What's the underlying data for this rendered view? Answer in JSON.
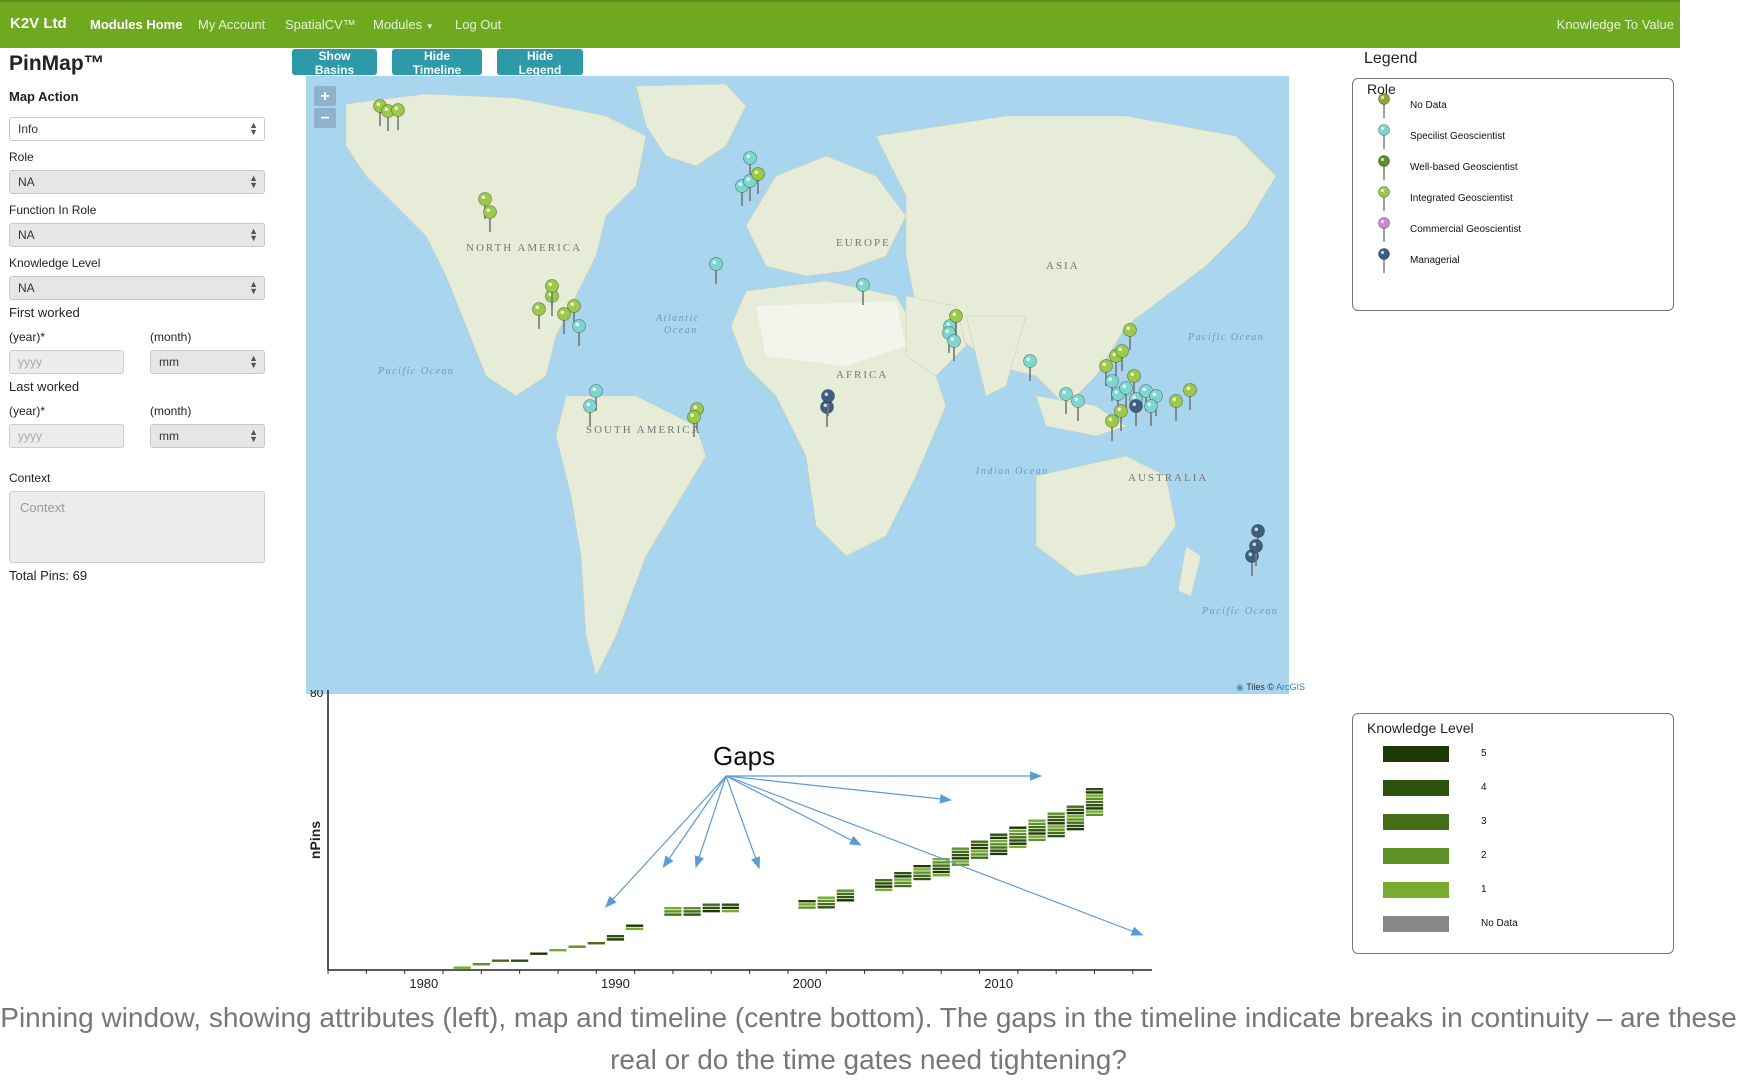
{
  "navbar": {
    "brand": "K2V Ltd",
    "items": [
      "Modules Home",
      "My Account",
      "SpatialCV™",
      "Modules",
      "Log Out"
    ],
    "tagline": "Knowledge To Value",
    "bg_color": "#6fa91f"
  },
  "sidebar": {
    "title": "PinMap™",
    "map_action_label": "Map Action",
    "map_action_value": "Info",
    "role_label": "Role",
    "role_value": "NA",
    "function_label": "Function In Role",
    "function_value": "NA",
    "knowledge_label": "Knowledge Level",
    "knowledge_value": "NA",
    "first_worked_label": "First worked",
    "last_worked_label": "Last worked",
    "year_label": "(year)*",
    "month_label": "(month)",
    "year_placeholder": "yyyy",
    "month_value": "mm",
    "context_label": "Context",
    "context_placeholder": "Context",
    "total_pins": "Total Pins: 69"
  },
  "toolbar": {
    "show_basins": "Show Basins",
    "hide_timeline": "Hide Timeline",
    "hide_legend": "Hide Legend"
  },
  "map": {
    "zoom_in": "+",
    "zoom_out": "−",
    "labels": {
      "north_america": "NORTH AMERICA",
      "south_america": "SOUTH AMERICA",
      "europe": "EUROPE",
      "asia": "ASIA",
      "africa": "AFRICA",
      "australia": "AUSTRALIA",
      "atlantic1": "Atlantic",
      "atlantic2": "Ocean",
      "pacific": "Pacific Ocean",
      "indian": "Indian Ocean"
    },
    "attribution_prefix": "Tiles ©",
    "attribution_link": "ArcGIS"
  },
  "legend": {
    "title": "Legend",
    "role_title": "Role",
    "roles": [
      {
        "label": "No Data",
        "color": "#8aa832"
      },
      {
        "label": "Specilist Geoscientist",
        "color": "#7fd6cf"
      },
      {
        "label": "Well-based Geoscientist",
        "color": "#5a8f2a"
      },
      {
        "label": "Integrated Geoscientist",
        "color": "#9dc94a"
      },
      {
        "label": "Commercial Geoscientist",
        "color": "#c88ad0"
      },
      {
        "label": "Managerial",
        "color": "#3f5f80"
      }
    ],
    "knowledge_title": "Knowledge Level",
    "knowledge_levels": [
      {
        "label": "5",
        "color": "#1d3a06"
      },
      {
        "label": "4",
        "color": "#2e5210"
      },
      {
        "label": "3",
        "color": "#446f18"
      },
      {
        "label": "2",
        "color": "#5f9226"
      },
      {
        "label": "1",
        "color": "#76ad2e"
      },
      {
        "label": "No Data",
        "color": "#888888"
      }
    ]
  },
  "timeline": {
    "ylabel": "nPins",
    "y_top_tick": "80",
    "x_ticks": [
      "1980",
      "1990",
      "2000",
      "2010"
    ],
    "annotation": "Gaps",
    "arrow_color": "#5b9bd5"
  },
  "chart_data": {
    "type": "bar",
    "ylabel": "nPins",
    "ylim": [
      0,
      80
    ],
    "x_ticks": [
      1980,
      1990,
      2000,
      2010
    ],
    "series_note_levels": [
      1,
      2,
      3,
      4,
      5
    ],
    "x": [
      1982,
      1983,
      1984,
      1985,
      1986,
      1987,
      1988,
      1989,
      1990,
      1991,
      1993,
      1994,
      1995,
      1996,
      2000,
      2001,
      2002,
      2004,
      2005,
      2006,
      2007,
      2008,
      2009,
      2010,
      2011,
      2012,
      2013,
      2014,
      2015
    ],
    "values": [
      1,
      2,
      3,
      3,
      5,
      6,
      7,
      8,
      10,
      13,
      18,
      18,
      19,
      19,
      20,
      21,
      23,
      26,
      28,
      30,
      32,
      35,
      37,
      39,
      41,
      43,
      45,
      47,
      52
    ]
  },
  "caption": "Pinning window, showing attributes (left), map and timeline (centre bottom). The gaps in the timeline indicate breaks in continuity – are these real or do the time gates need tightening?"
}
